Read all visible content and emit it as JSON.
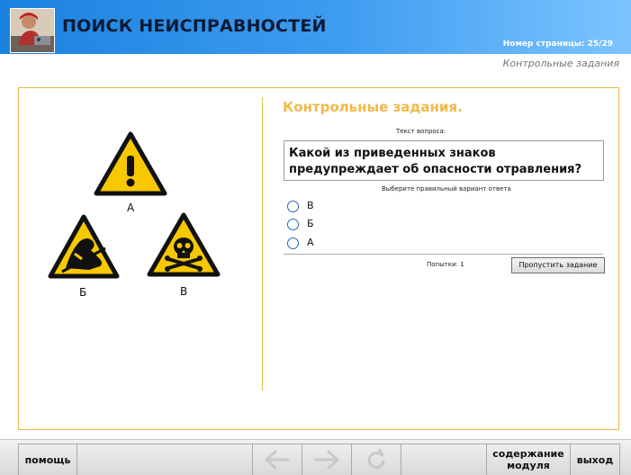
{
  "header": {
    "title": "ПОИСК НЕИСПРАВНОСТЕЙ",
    "page_counter": "Номер страницы: 25/29"
  },
  "section_subtitle": "Контрольные задания",
  "signs": [
    {
      "label": "А",
      "icon": "exclamation-warning-icon"
    },
    {
      "label": "Б",
      "icon": "electrostatic-warning-icon"
    },
    {
      "label": "В",
      "icon": "toxic-warning-icon"
    }
  ],
  "quiz": {
    "title": "Контрольные задания.",
    "question_caption": "Текст вопроса:",
    "question": "Какой из приведенных знаков предупреждает об опасности отравления?",
    "answer_caption": "Выберите правильный вариант ответа",
    "options": [
      "В",
      "Б",
      "А"
    ],
    "attempts": "Попытки: 1",
    "skip_label": "Пропустить задание"
  },
  "footer": {
    "help": "помощь",
    "contents": "содержание модуля",
    "exit": "выход",
    "icons": [
      "arrow-left-icon",
      "arrow-right-icon",
      "refresh-icon"
    ]
  },
  "colors": {
    "header_start": "#1a82e0",
    "header_end": "#7cc4ff",
    "accent": "#f0b94a",
    "sign_yellow": "#f7c800",
    "radio": "#2a62b8"
  }
}
